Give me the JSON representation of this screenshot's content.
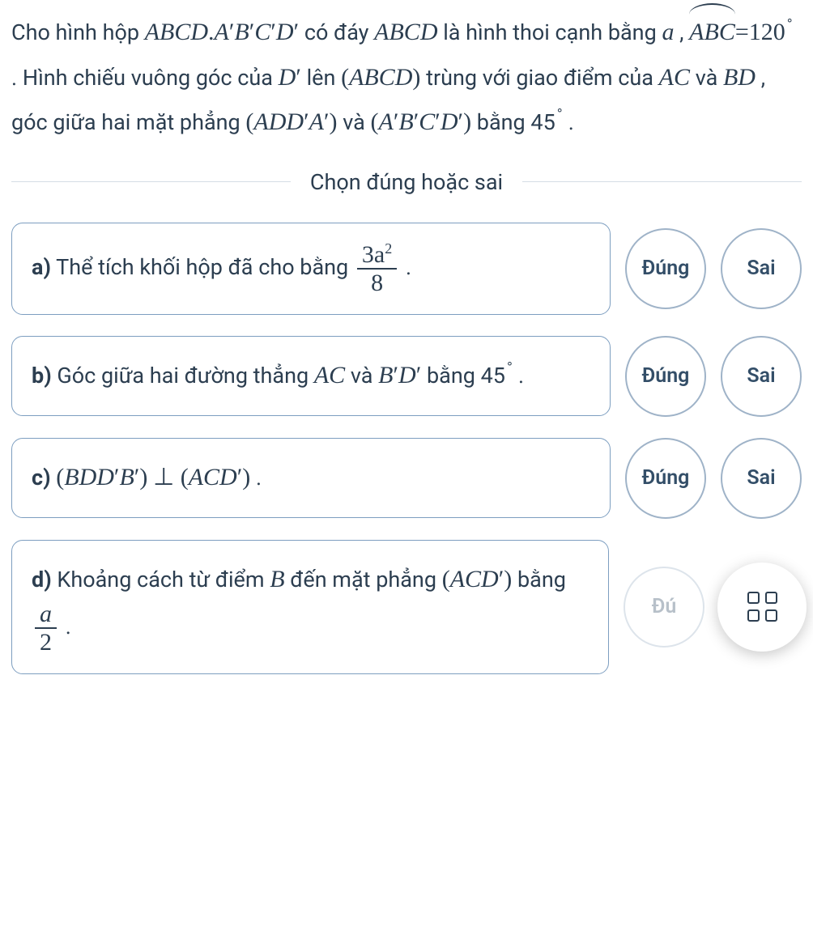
{
  "prompt": {
    "p1a": "Cho hình hộp ",
    "p1b": " có đáy ",
    "p1c": " là hình thoi cạnh bằng ",
    "p1d": ",  ",
    "p1e": " . Hình chiếu vuông góc của ",
    "p1f": " lên ",
    "p1g": " trùng với giao điểm của ",
    "p1h": " và ",
    "p1i": ", góc giữa hai mặt phẳng ",
    "p1j": " và ",
    "p1k": " bằng 45",
    "p1l": " .",
    "math": {
      "box": "ABCD.A′B′C′D′",
      "ABCD": "ABCD",
      "a": "a",
      "arcABC": "ABC",
      "eq120": "=120",
      "Dp": "D′",
      "paren_ABCD": "(ABCD)",
      "AC": "AC",
      "BD": "BD",
      "ADDpAp": "(ADD′A′)",
      "ApBpCpDp": "(A′B′C′D′)",
      "deg": "∘"
    }
  },
  "divider_label": "Chọn đúng hoặc sai",
  "answers": {
    "true": "Đúng",
    "false": "Sai",
    "true_cut": "Đú"
  },
  "questions": {
    "a": {
      "label": "a)",
      "text_before": " Thể tích khối hộp đã cho bằng ",
      "frac_num": "3a",
      "frac_num_sup": "2",
      "frac_den": "8",
      "text_after": " ."
    },
    "b": {
      "label": "b)",
      "text_before": " Góc giữa hai đường thẳng ",
      "math1": "AC",
      "mid": " và ",
      "math2": "B′D′",
      "text_after": " bằng 45",
      "deg": "∘",
      "tail": " ."
    },
    "c": {
      "label": "c)",
      "math1": "(BDD′B′)",
      "perp": " ⊥ ",
      "math2": "(ACD′)",
      "tail": " ."
    },
    "d": {
      "label": "d)",
      "text_before": " Khoảng cách từ điểm ",
      "mathB": "B",
      "mid": " đến mặt phẳng ",
      "mathPlane": "(ACD′)",
      "text_after": " bằng ",
      "frac_num": "a",
      "frac_den": "2",
      "tail": " ."
    }
  }
}
